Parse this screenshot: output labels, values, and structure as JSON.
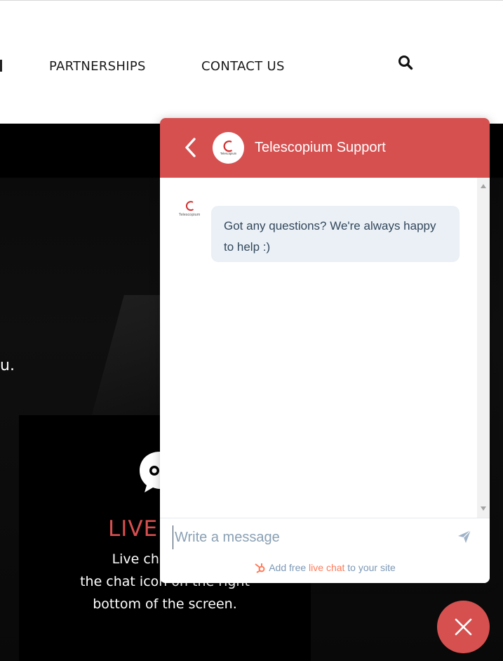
{
  "header": {
    "nav": [
      {
        "label": "PARTNERSHIPS"
      },
      {
        "label": "CONTACT US"
      }
    ],
    "search_icon": "search-icon"
  },
  "hero": {
    "fragment_text": "u.",
    "card": {
      "title": "LIVE",
      "lines": [
        "Live chat with u",
        "the chat icon on the right",
        "bottom of the screen."
      ]
    }
  },
  "chat": {
    "title": "Telescopium Support",
    "brand_color": "#d65050",
    "avatar_logo_text": "Telescopium",
    "messages": [
      {
        "text": "Got any questions? We're always happy to help :)"
      }
    ],
    "composer": {
      "placeholder": "Write a message",
      "value": ""
    },
    "powered": {
      "prefix": "Add free ",
      "link": "live chat",
      "suffix": " to your site"
    }
  },
  "colors": {
    "accent": "#d65050",
    "hubspot_orange": "#ff7a59",
    "bubble_bg": "#eaf0f6",
    "bubble_text": "#33475b"
  }
}
